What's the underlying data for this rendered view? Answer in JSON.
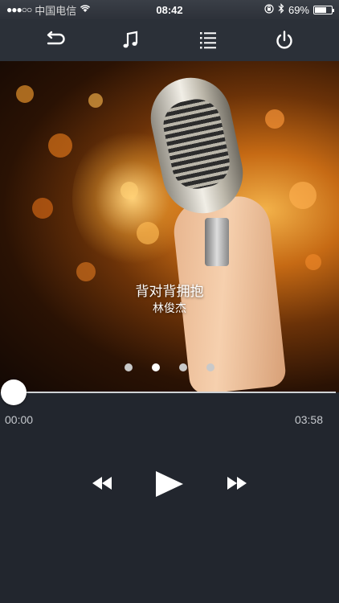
{
  "status_bar": {
    "signal_dots": "●●●○○",
    "carrier": "中国电信",
    "wifi_icon": "wifi-icon",
    "time": "08:42",
    "battery_percent": "69%",
    "battery_level": 0.69
  },
  "toolbar": {
    "items": [
      {
        "name": "back-icon"
      },
      {
        "name": "music-note-icon"
      },
      {
        "name": "playlist-icon"
      },
      {
        "name": "power-icon"
      }
    ]
  },
  "now_playing": {
    "title": "背对背拥抱",
    "artist": "林俊杰",
    "page_count": 4,
    "active_page": 1
  },
  "progress": {
    "elapsed": "00:00",
    "total": "03:58",
    "fraction": 0.0
  },
  "controls": {
    "rewind_icon": "rewind-icon",
    "play_icon": "play-icon",
    "forward_icon": "fast-forward-icon"
  },
  "colors": {
    "background": "#22262e",
    "toolbar": "#2b3038",
    "accent": "#ffffff"
  }
}
